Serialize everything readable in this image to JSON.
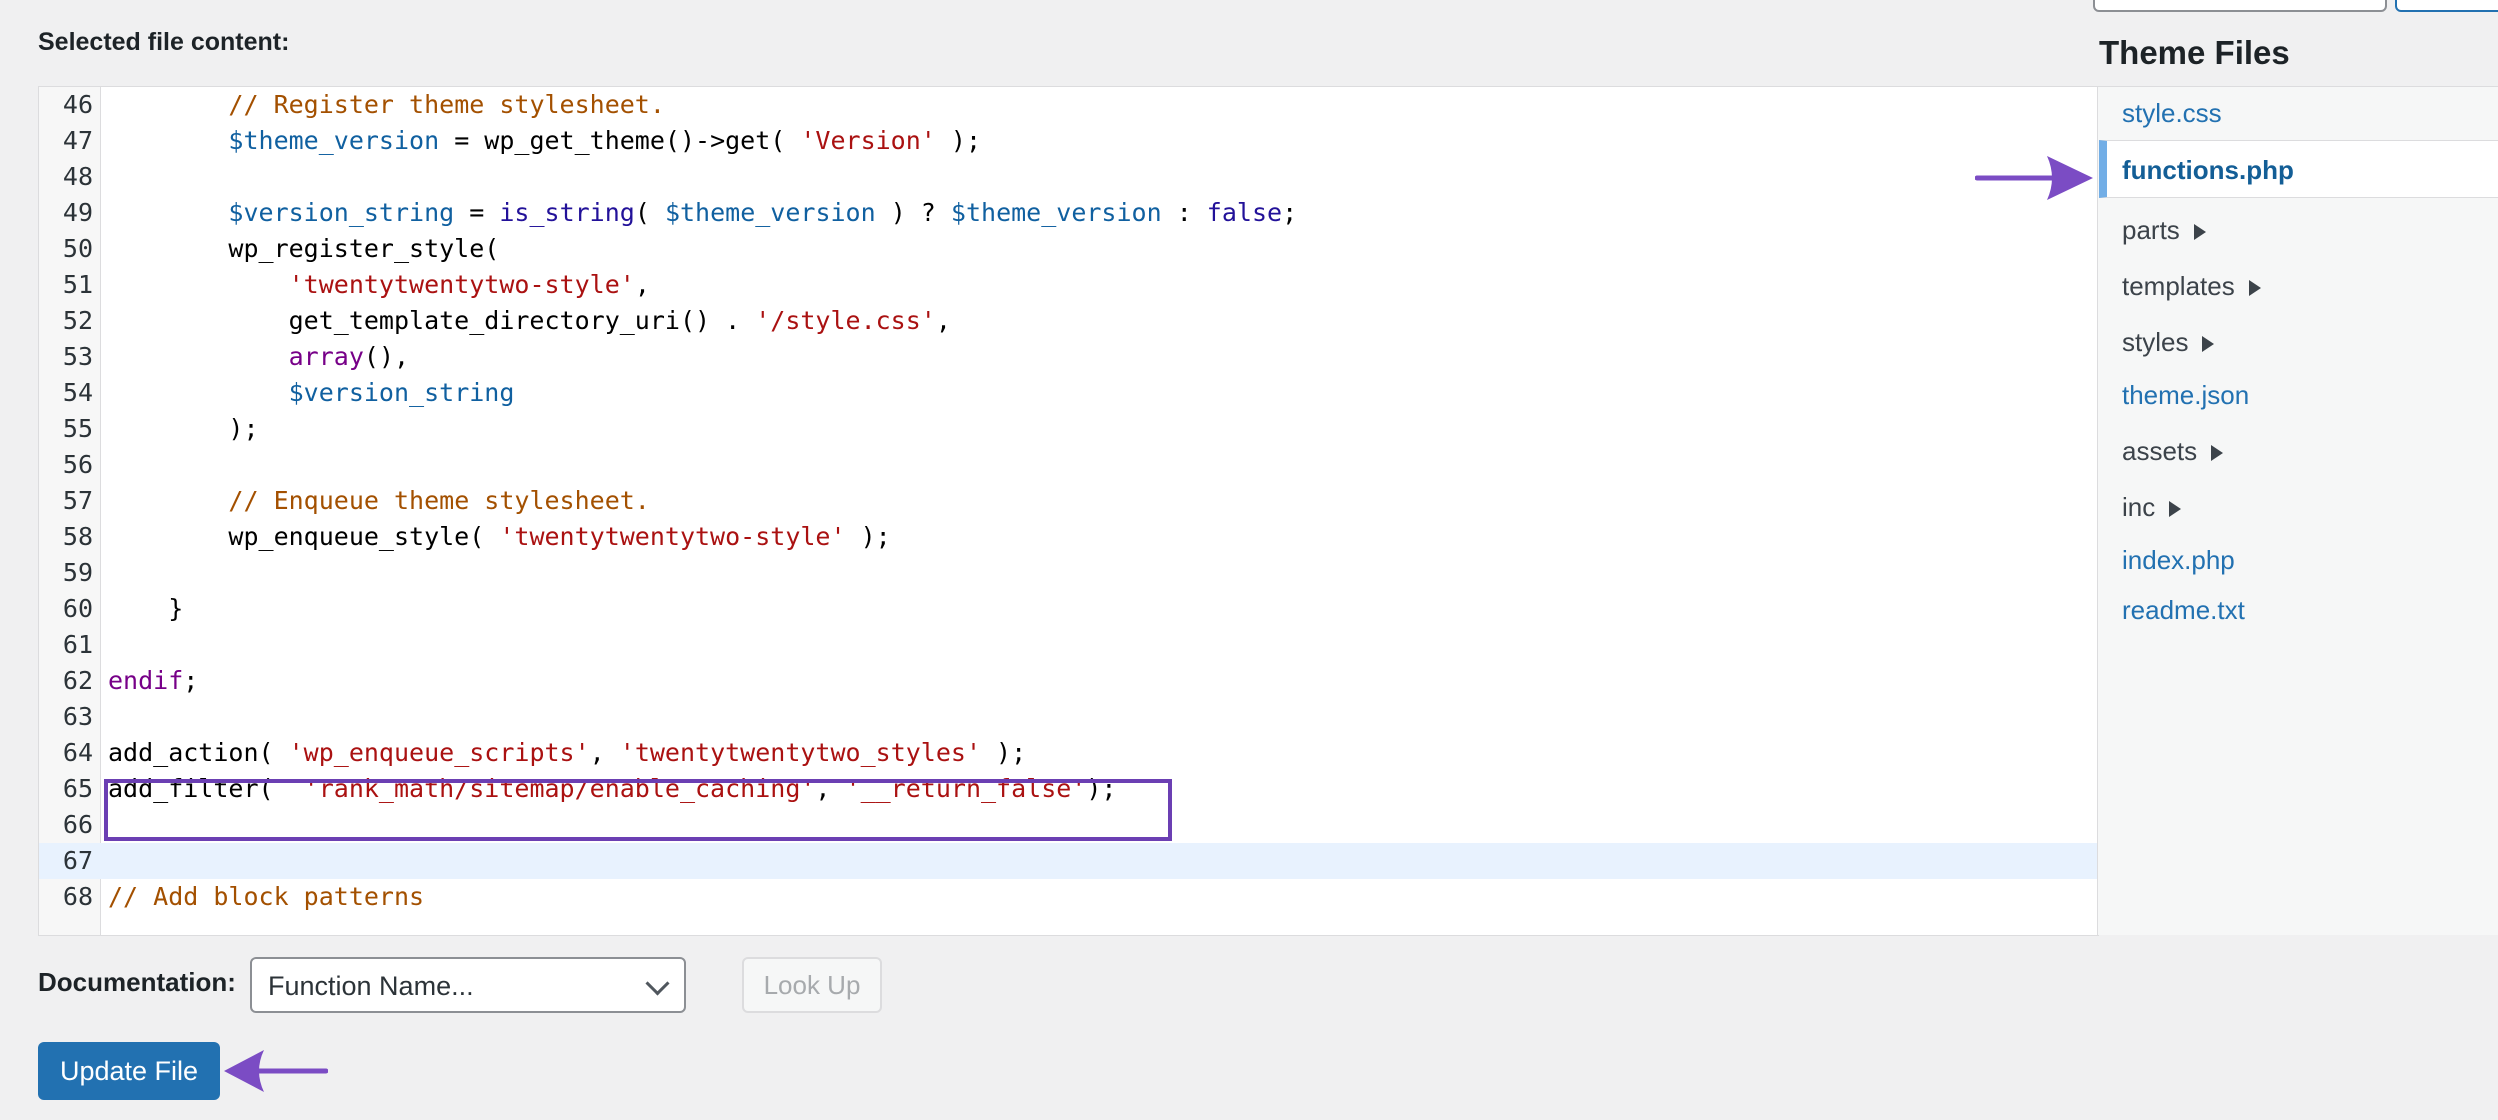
{
  "labels": {
    "selected_file_content": "Selected file content:",
    "theme_files_title": "Theme Files",
    "documentation": "Documentation:"
  },
  "documentation": {
    "selected_option": "Function Name...",
    "lookup_label": "Look Up"
  },
  "update_button_label": "Update File",
  "theme_files": [
    {
      "label": "style.css",
      "type": "file"
    },
    {
      "label": "functions.php",
      "type": "file",
      "active": true
    },
    {
      "label": "parts",
      "type": "folder"
    },
    {
      "label": "templates",
      "type": "folder"
    },
    {
      "label": "styles",
      "type": "folder"
    },
    {
      "label": "theme.json",
      "type": "file"
    },
    {
      "label": "assets",
      "type": "folder"
    },
    {
      "label": "inc",
      "type": "folder"
    },
    {
      "label": "index.php",
      "type": "file"
    },
    {
      "label": "readme.txt",
      "type": "file"
    }
  ],
  "code": {
    "active_line": "67",
    "lines": [
      {
        "n": "46",
        "segments": [
          {
            "t": "        "
          },
          {
            "t": "// Register theme stylesheet.",
            "c": "com"
          }
        ]
      },
      {
        "n": "47",
        "segments": [
          {
            "t": "        "
          },
          {
            "t": "$theme_version",
            "c": "var"
          },
          {
            "t": " = wp_get_theme()->get( "
          },
          {
            "t": "'Version'",
            "c": "str"
          },
          {
            "t": " );"
          }
        ]
      },
      {
        "n": "48",
        "segments": []
      },
      {
        "n": "49",
        "segments": [
          {
            "t": "        "
          },
          {
            "t": "$version_string",
            "c": "var"
          },
          {
            "t": " = "
          },
          {
            "t": "is_string",
            "c": "kwv"
          },
          {
            "t": "( "
          },
          {
            "t": "$theme_version",
            "c": "var"
          },
          {
            "t": " ) ? "
          },
          {
            "t": "$theme_version",
            "c": "var"
          },
          {
            "t": " : "
          },
          {
            "t": "false",
            "c": "kwv"
          },
          {
            "t": ";"
          }
        ]
      },
      {
        "n": "50",
        "segments": [
          {
            "t": "        wp_register_style("
          }
        ]
      },
      {
        "n": "51",
        "segments": [
          {
            "t": "            "
          },
          {
            "t": "'twentytwentytwo-style'",
            "c": "str"
          },
          {
            "t": ","
          }
        ]
      },
      {
        "n": "52",
        "segments": [
          {
            "t": "            get_template_directory_uri() . "
          },
          {
            "t": "'/style.css'",
            "c": "str"
          },
          {
            "t": ","
          }
        ]
      },
      {
        "n": "53",
        "segments": [
          {
            "t": "            "
          },
          {
            "t": "array",
            "c": "kw"
          },
          {
            "t": "(),"
          }
        ]
      },
      {
        "n": "54",
        "segments": [
          {
            "t": "            "
          },
          {
            "t": "$version_string",
            "c": "var"
          }
        ]
      },
      {
        "n": "55",
        "segments": [
          {
            "t": "        );"
          }
        ]
      },
      {
        "n": "56",
        "segments": []
      },
      {
        "n": "57",
        "segments": [
          {
            "t": "        "
          },
          {
            "t": "// Enqueue theme stylesheet.",
            "c": "com"
          }
        ]
      },
      {
        "n": "58",
        "segments": [
          {
            "t": "        wp_enqueue_style( "
          },
          {
            "t": "'twentytwentytwo-style'",
            "c": "str"
          },
          {
            "t": " );"
          }
        ]
      },
      {
        "n": "59",
        "segments": []
      },
      {
        "n": "60",
        "segments": [
          {
            "t": "    }"
          }
        ]
      },
      {
        "n": "61",
        "segments": []
      },
      {
        "n": "62",
        "segments": [
          {
            "t": "endif",
            "c": "kw"
          },
          {
            "t": ";"
          }
        ]
      },
      {
        "n": "63",
        "segments": []
      },
      {
        "n": "64",
        "segments": [
          {
            "t": "add_action( "
          },
          {
            "t": "'wp_enqueue_scripts'",
            "c": "str"
          },
          {
            "t": ", "
          },
          {
            "t": "'twentytwentytwo_styles'",
            "c": "str"
          },
          {
            "t": " );"
          }
        ]
      },
      {
        "n": "65",
        "segments": [
          {
            "t": "add_filter(  "
          },
          {
            "t": "'rank_math/sitemap/enable_caching'",
            "c": "str"
          },
          {
            "t": ", "
          },
          {
            "t": "'__return_false'",
            "c": "str"
          },
          {
            "t": ");"
          }
        ]
      },
      {
        "n": "66",
        "segments": []
      },
      {
        "n": "67",
        "segments": []
      },
      {
        "n": "68",
        "segments": [
          {
            "t": "// Add block patterns",
            "c": "com"
          }
        ]
      }
    ]
  }
}
